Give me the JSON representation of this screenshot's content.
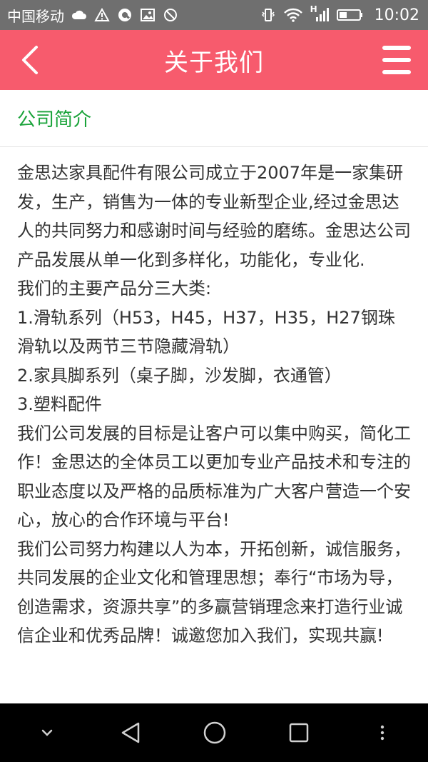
{
  "status_bar": {
    "carrier": "中国移动",
    "network_label": "H",
    "time": "10:02",
    "icons": [
      "cloud-icon",
      "warning-icon",
      "q-app-icon",
      "image-icon",
      "blocked-icon",
      "vibrate-icon",
      "wifi-icon",
      "signal-icon",
      "battery-icon"
    ]
  },
  "header": {
    "title": "关于我们",
    "back_icon": "chevron-left-icon",
    "menu_icon": "hamburger-menu-icon",
    "color": "#f75b6d"
  },
  "section": {
    "title": "公司简介",
    "title_color": "#1aa33a"
  },
  "content": {
    "paragraphs": [
      "金思达家具配件有限公司成立于2007年是一家集研发，生产，销售为一体的专业新型企业,经过金思达人的共同努力和感谢时间与经验的磨练。金思达公司产品发展从单一化到多样化，功能化，专业化.",
      "我们的主要产品分三大类:",
      "1.滑轨系列（H53，H45，H37，H35，H27钢珠滑轨以及两节三节隐藏滑轨）",
      "2.家具脚系列（桌子脚，沙发脚，衣通管）",
      "3.塑料配件",
      "我们公司发展的目标是让客户可以集中购买，简化工作！金思达的全体员工以更加专业产品技术和专注的职业态度以及严格的品质标准为广大客户营造一个安心，放心的合作环境与平台!",
      "我们公司努力构建以人为本，开拓创新，诚信服务，共同发展的企业文化和管理思想；奉行“市场为导，创造需求，资源共享”的多赢营销理念来打造行业诚信企业和优秀品牌！诚邀您加入我们，实现共赢!"
    ]
  },
  "nav_bar": {
    "icons": [
      "chevron-down-icon",
      "back-triangle-icon",
      "home-circle-icon",
      "recents-square-icon",
      "more-dots-icon"
    ]
  }
}
